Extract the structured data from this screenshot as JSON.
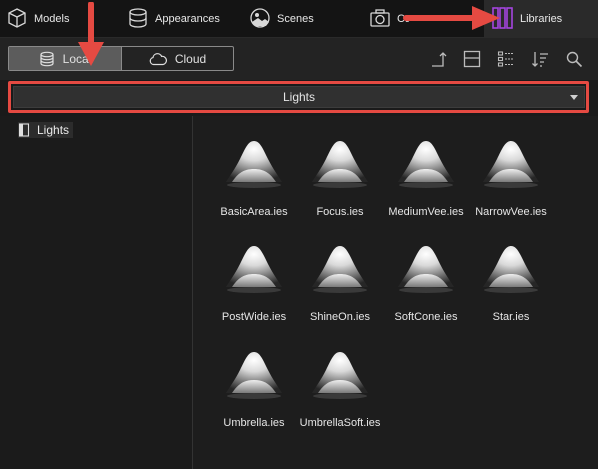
{
  "tabs": [
    {
      "label": "Models",
      "icon": "cube-icon"
    },
    {
      "label": "Appearances",
      "icon": "cylinder-icon"
    },
    {
      "label": "Scenes",
      "icon": "landscape-icon"
    },
    {
      "label": "Cameras",
      "icon": "camera-icon"
    },
    {
      "label": "Libraries",
      "icon": "library-books-icon"
    }
  ],
  "source_toggle": {
    "local_label": "Local",
    "cloud_label": "Cloud",
    "selected": "Local"
  },
  "library_dropdown": {
    "value": "Lights"
  },
  "tree": {
    "items": [
      {
        "label": "Lights"
      }
    ]
  },
  "lights": [
    {
      "name": "BasicArea.ies"
    },
    {
      "name": "Focus.ies"
    },
    {
      "name": "MediumVee.ies"
    },
    {
      "name": "NarrowVee.ies"
    },
    {
      "name": "PostWide.ies"
    },
    {
      "name": "ShineOn.ies"
    },
    {
      "name": "SoftCone.ies"
    },
    {
      "name": "Star.ies"
    },
    {
      "name": "Umbrella.ies"
    },
    {
      "name": "UmbrellaSoft.ies"
    }
  ],
  "colors": {
    "annotation_red": "#e54a42",
    "libraries_icon": "#a545e0",
    "background": "#1d1d1d"
  }
}
